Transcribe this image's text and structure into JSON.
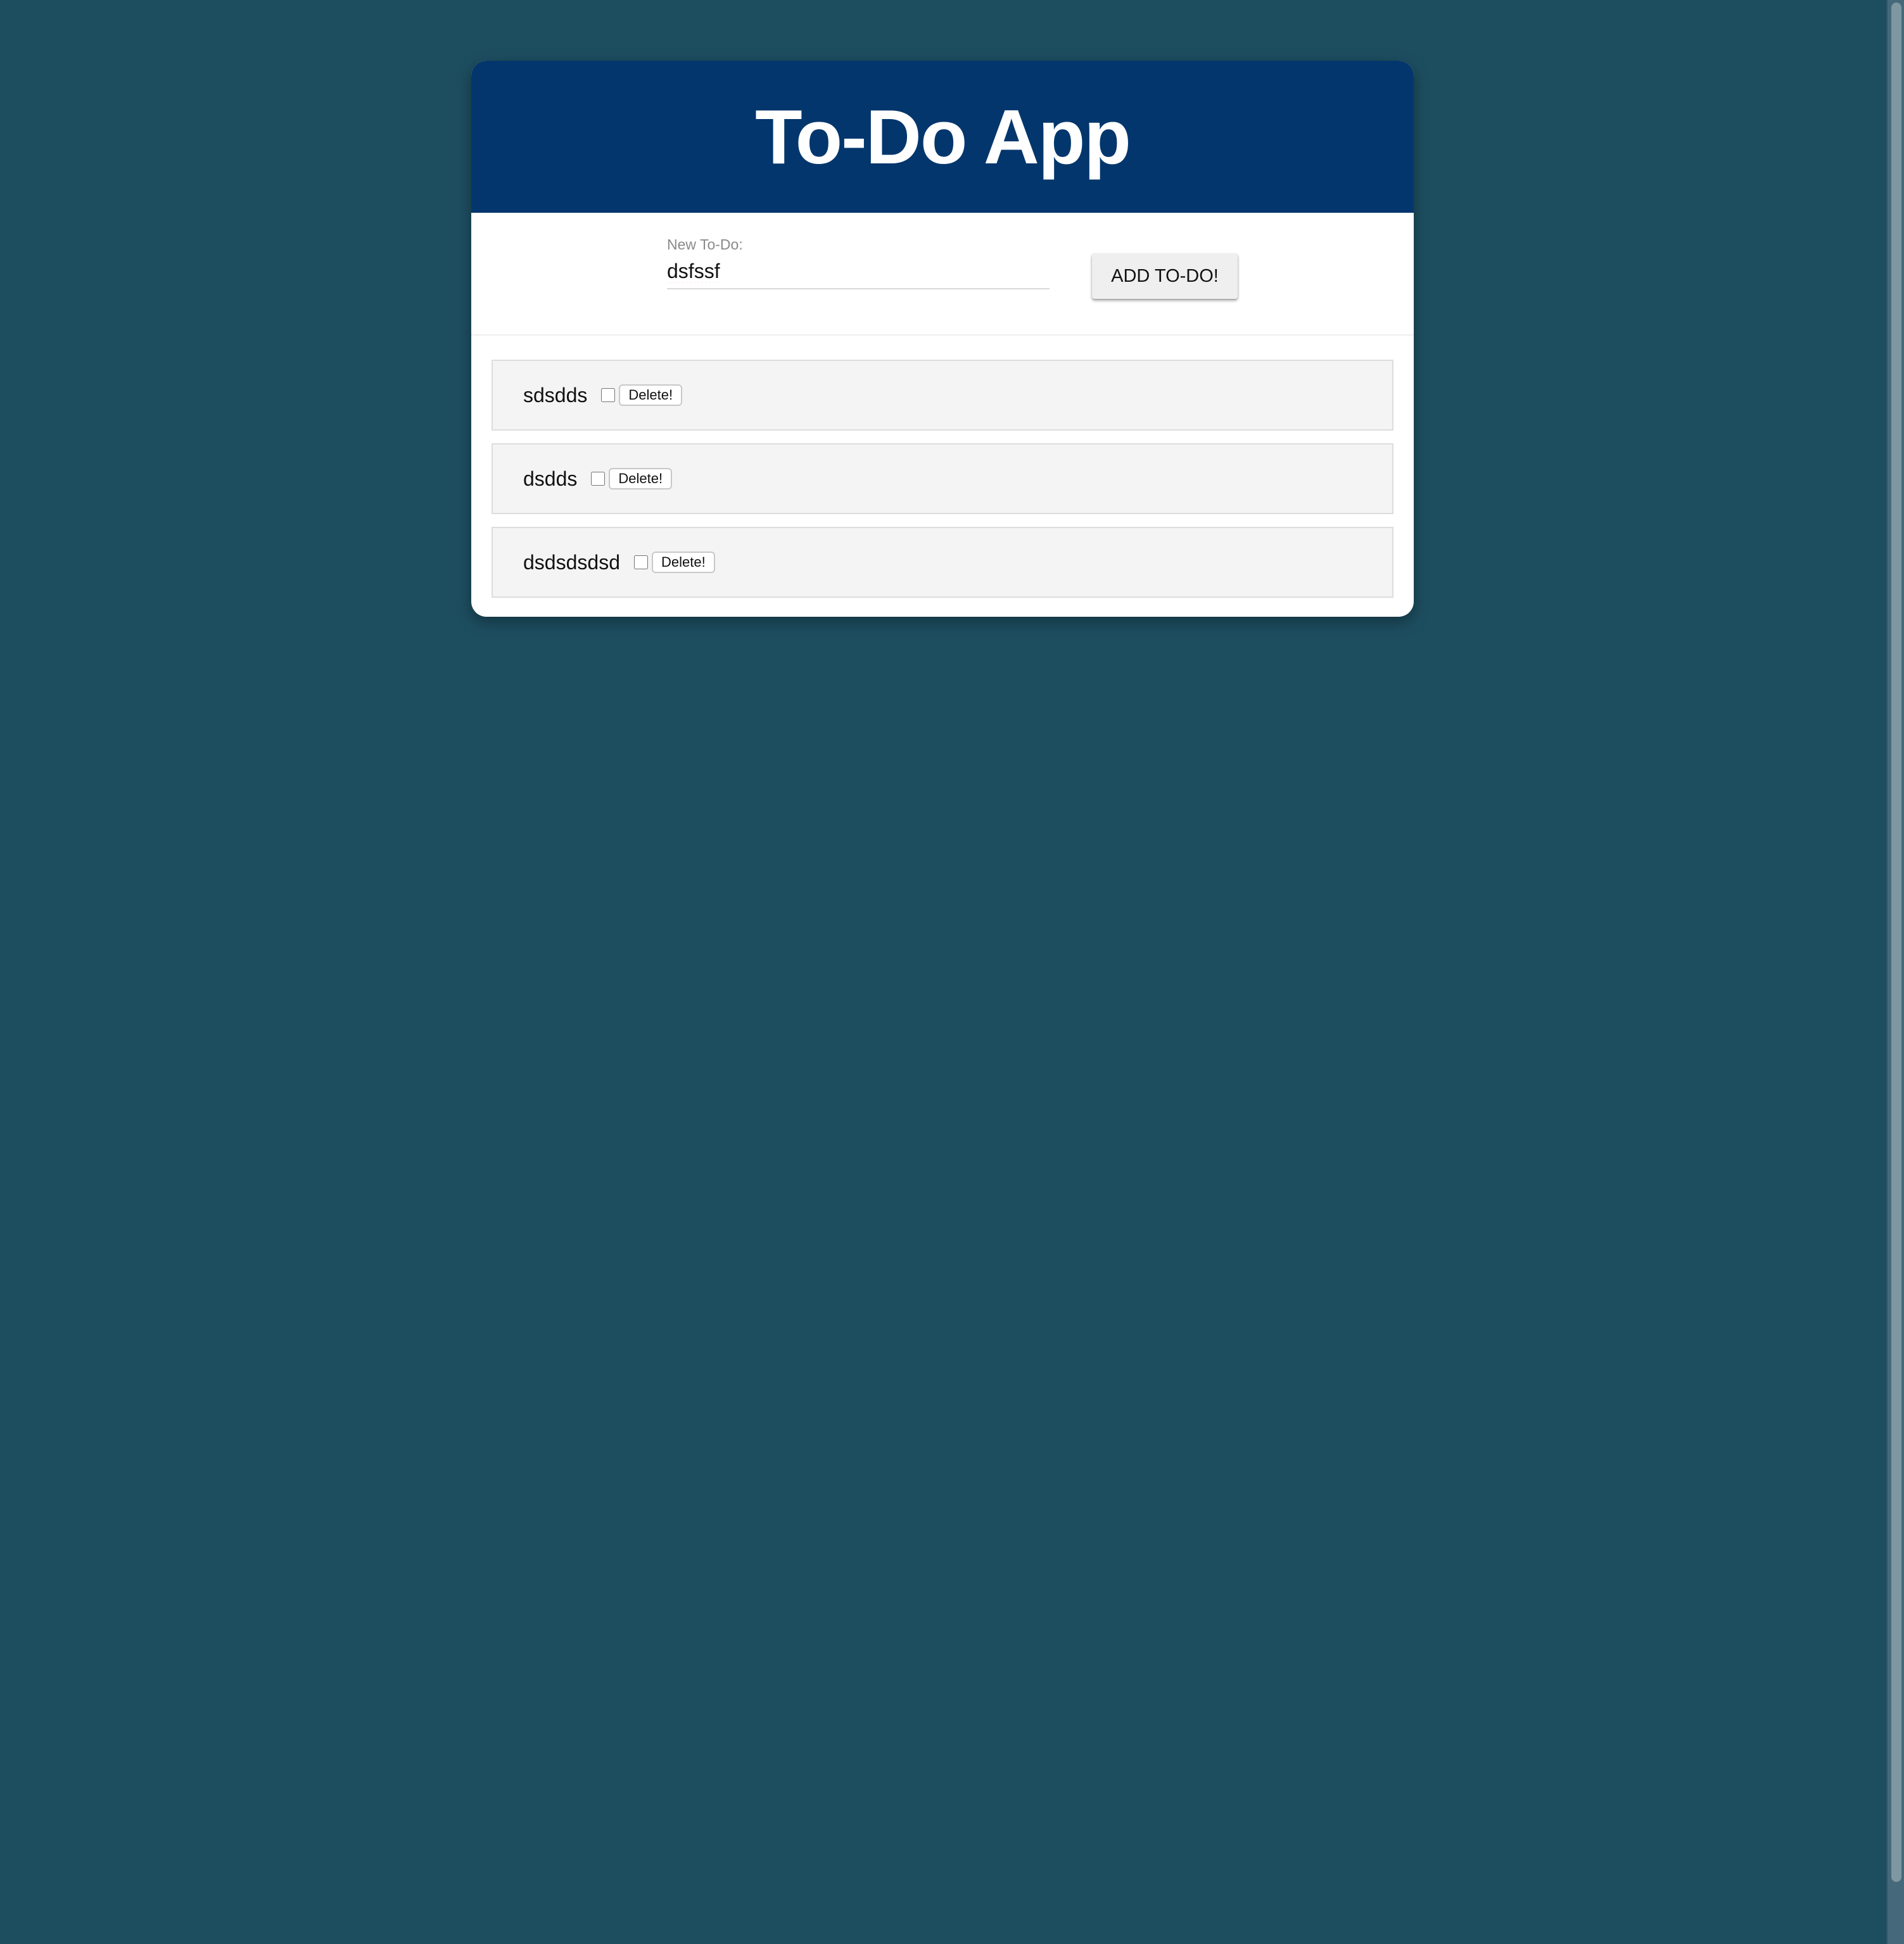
{
  "header": {
    "title": "To-Do App"
  },
  "form": {
    "label": "New To-Do:",
    "input_value": "dsfssf",
    "add_button_label": "ADD TO-DO!"
  },
  "todos": [
    {
      "text": "sdsdds",
      "done": false,
      "delete_label": "Delete!"
    },
    {
      "text": "dsdds",
      "done": false,
      "delete_label": "Delete!"
    },
    {
      "text": "dsdsdsdsd",
      "done": false,
      "delete_label": "Delete!"
    }
  ],
  "colors": {
    "page_background": "#1d4e60",
    "header_background": "#03366c",
    "card_background": "#ffffff",
    "item_background": "#f4f4f4"
  }
}
